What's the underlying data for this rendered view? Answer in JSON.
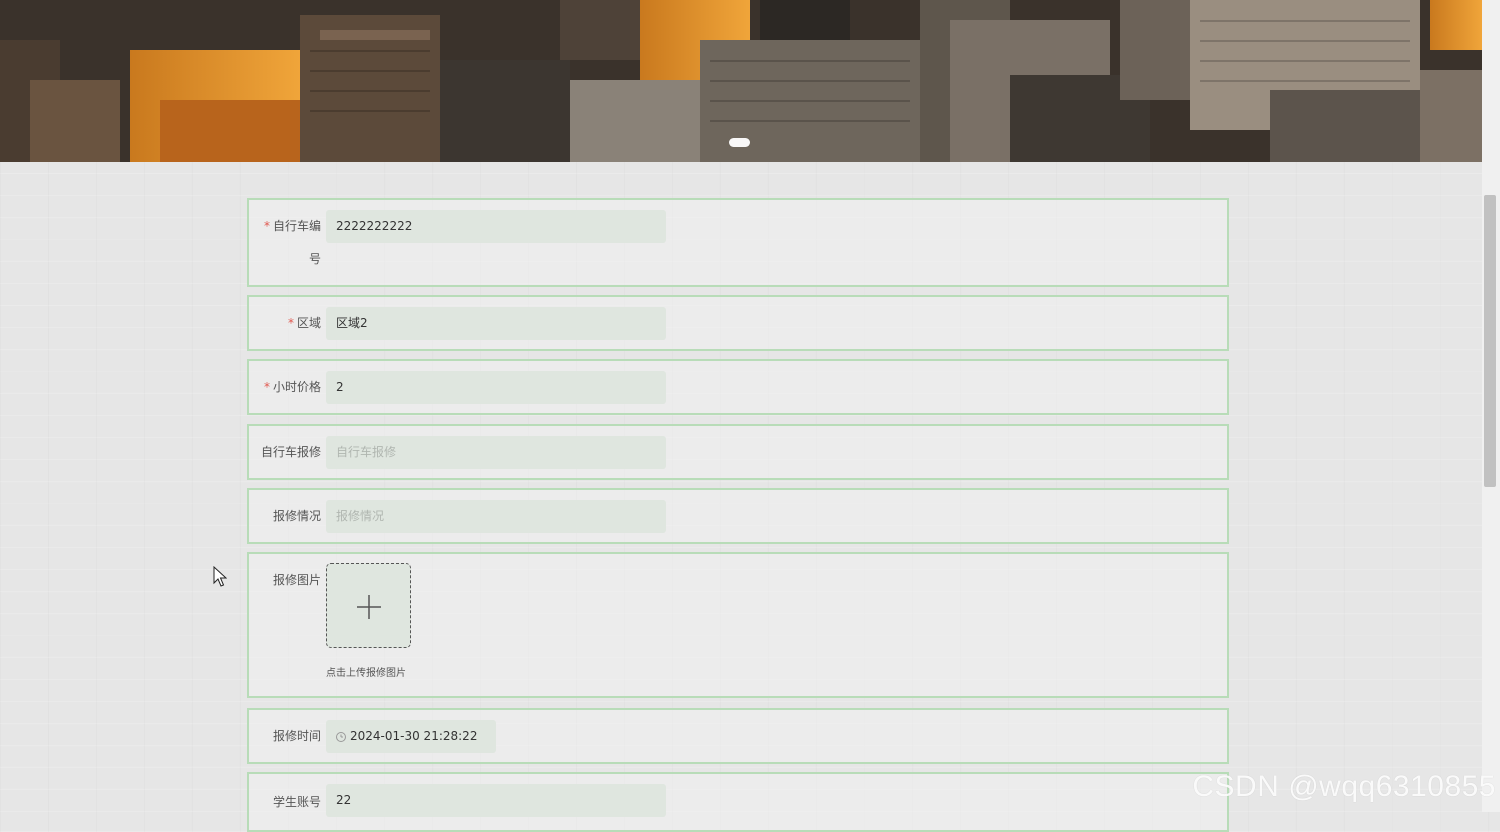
{
  "banner": {
    "dot_count": 1
  },
  "form": {
    "fields": [
      {
        "label_line1": "自行车编",
        "label_line2": "号",
        "required": "*",
        "value": "2222222222"
      },
      {
        "label": "区域",
        "required": "*",
        "value": "区域2"
      },
      {
        "label": "小时价格",
        "required": "*",
        "value": "2"
      },
      {
        "label": "自行车报修",
        "placeholder": "自行车报修"
      },
      {
        "label": "报修情况",
        "placeholder": "报修情况"
      },
      {
        "label": "报修图片",
        "hint": "点击上传报修图片"
      },
      {
        "label": "报修时间",
        "value": "2024-01-30 21:28:22"
      },
      {
        "label": "学生账号",
        "value": "22"
      }
    ]
  },
  "watermark": "CSDN @wqq6310855",
  "colors": {
    "border": "#b8dcb8",
    "field_bg": "#dfe6df",
    "required": "#e0584f"
  },
  "icons": {
    "upload": "plus-icon",
    "time": "clock-icon",
    "pointer": "cursor-icon"
  }
}
